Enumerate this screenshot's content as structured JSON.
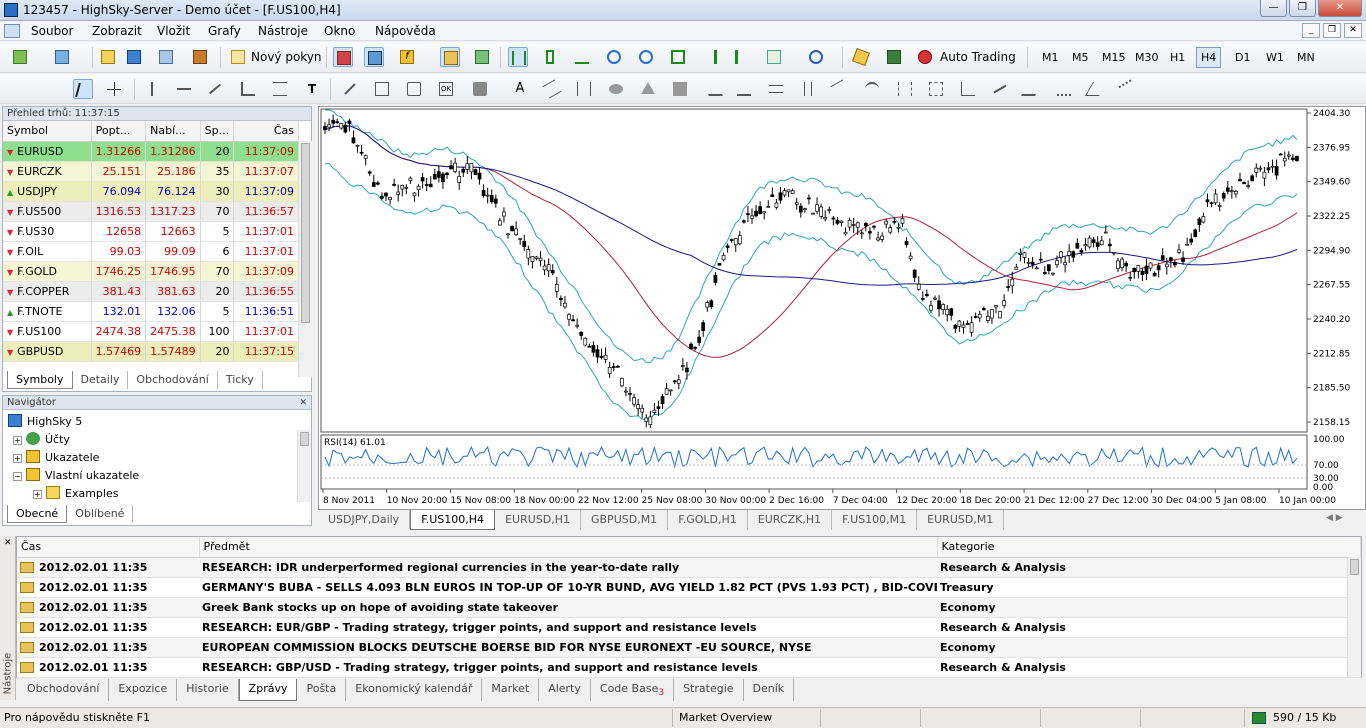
{
  "window": {
    "title": "123457 - HighSky-Server - Demo účet - [F.US100,H4]"
  },
  "menu": [
    "Soubor",
    "Zobrazit",
    "Vložit",
    "Grafy",
    "Nástroje",
    "Okno",
    "Nápověda"
  ],
  "toolbar": {
    "new_order_label": "Nový pokyn",
    "auto_trading_label": "Auto Trading"
  },
  "timeframes": [
    "M1",
    "M5",
    "M15",
    "M30",
    "H1",
    "H4",
    "D1",
    "W1",
    "MN"
  ],
  "timeframe_active": "H4",
  "market_watch": {
    "header": "Přehled trhů: 11:37:15",
    "columns": [
      "Symbol",
      "Popt...",
      "Nabí...",
      "Sp...",
      "Čas"
    ],
    "rows": [
      {
        "symbol": "EURUSD",
        "bid": "1.31266",
        "ask": "1.31286",
        "spread": "20",
        "time": "11:37:09",
        "dir": "dn",
        "bg": "#8ee08e"
      },
      {
        "symbol": "EURCZK",
        "bid": "25.151",
        "ask": "25.186",
        "spread": "35",
        "time": "11:37:07",
        "dir": "dn",
        "bg": "#f6f6d4"
      },
      {
        "symbol": "USDJPY",
        "bid": "76.094",
        "ask": "76.124",
        "spread": "30",
        "time": "11:37:09",
        "dir": "up",
        "bg": "#eeeebb"
      },
      {
        "symbol": "F.US500",
        "bid": "1316.53",
        "ask": "1317.23",
        "spread": "70",
        "time": "11:36:57",
        "dir": "dn",
        "bg": "#ececec"
      },
      {
        "symbol": "F.US30",
        "bid": "12658",
        "ask": "12663",
        "spread": "5",
        "time": "11:37:01",
        "dir": "dn",
        "bg": "#ffffff"
      },
      {
        "symbol": "F.OIL",
        "bid": "99.03",
        "ask": "99.09",
        "spread": "6",
        "time": "11:37:01",
        "dir": "dn",
        "bg": "#ffffff"
      },
      {
        "symbol": "F.GOLD",
        "bid": "1746.25",
        "ask": "1746.95",
        "spread": "70",
        "time": "11:37:09",
        "dir": "dn",
        "bg": "#f6f6d4"
      },
      {
        "symbol": "F.COPPER",
        "bid": "381.43",
        "ask": "381.63",
        "spread": "20",
        "time": "11:36:55",
        "dir": "dn",
        "bg": "#ececec"
      },
      {
        "symbol": "F.TNOTE",
        "bid": "132.01",
        "ask": "132.06",
        "spread": "5",
        "time": "11:36:51",
        "dir": "up",
        "bg": "#ffffff"
      },
      {
        "symbol": "F.US100",
        "bid": "2474.38",
        "ask": "2475.38",
        "spread": "100",
        "time": "11:37:01",
        "dir": "dn",
        "bg": "#ffffff"
      },
      {
        "symbol": "GBPUSD",
        "bid": "1.57469",
        "ask": "1.57489",
        "spread": "20",
        "time": "11:37:15",
        "dir": "dn",
        "bg": "#eeeebb"
      }
    ],
    "tabs": [
      "Symboly",
      "Detaily",
      "Obchodování",
      "Ticky"
    ]
  },
  "navigator": {
    "header": "Navigátor",
    "items": [
      "HighSky 5",
      "Účty",
      "Ukazatele",
      "Vlastní ukazatele",
      "Examples"
    ],
    "tabs": [
      "Obecné",
      "Oblíbené"
    ]
  },
  "chart": {
    "price_labels": [
      "2404.30",
      "2376.95",
      "2349.60",
      "2322.25",
      "2294.90",
      "2267.55",
      "2240.20",
      "2212.85",
      "2185.50",
      "2158.15"
    ],
    "rsi_label": "RSI(14) 61.01",
    "rsi_labels": [
      "100.00",
      "70.00",
      "30.00",
      "0.00"
    ],
    "date_labels": [
      "8 Nov 2011",
      "10 Nov 20:00",
      "15 Nov 08:00",
      "18 Nov 00:00",
      "22 Nov 12:00",
      "25 Nov 08:00",
      "30 Nov 00:00",
      "2 Dec 16:00",
      "7 Dec 04:00",
      "12 Dec 20:00",
      "18 Dec 20:00",
      "21 Dec 12:00",
      "27 Dec 12:00",
      "30 Dec 04:00",
      "5 Jan 08:00",
      "10 Jan 00:00"
    ],
    "colors": {
      "bollinger": "#2aa7b8",
      "ma_slow": "#1a1a80",
      "ma_fast": "#b0203a",
      "rsi": "#1e6fcf",
      "candles": "#000000"
    }
  },
  "chart_tabs": [
    "USDJPY,Daily",
    "F.US100,H4",
    "EURUSD,H1",
    "GBPUSD,M1",
    "F.GOLD,H1",
    "EURCZK,H1",
    "F.US100,M1",
    "EURUSD,M1"
  ],
  "news": {
    "columns": [
      "Čas",
      "Předmět",
      "Kategorie"
    ],
    "rows": [
      {
        "time": "2012.02.01 11:35",
        "subject": "RESEARCH: IDR underperformed regional currencies in the year-to-date rally",
        "category": "Research & Analysis"
      },
      {
        "time": "2012.02.01 11:35",
        "subject": "GERMANY'S BUBA - SELLS 4.093 BLN EUROS IN TOP-UP OF 10-YR BUND, AVG YIELD 1.82 PCT (PVS 1.93 PCT) , BID-COVER 1.4 (PV...",
        "category": "Treasury"
      },
      {
        "time": "2012.02.01 11:35",
        "subject": "Greek Bank stocks up on hope of avoiding state takeover",
        "category": "Economy"
      },
      {
        "time": "2012.02.01 11:35",
        "subject": "RESEARCH: EUR/GBP - Trading strategy, trigger points, and support and resistance levels",
        "category": "Research & Analysis"
      },
      {
        "time": "2012.02.01 11:35",
        "subject": "EUROPEAN COMMISSION BLOCKS DEUTSCHE BOERSE BID FOR NYSE EURONEXT -EU SOURCE, NYSE",
        "category": "Economy"
      },
      {
        "time": "2012.02.01 11:35",
        "subject": "RESEARCH: GBP/USD - Trading strategy, trigger points, and support and resistance levels",
        "category": "Research & Analysis"
      }
    ]
  },
  "terminal_label": "Nástroje",
  "terminal_tabs": [
    "Obchodování",
    "Expozice",
    "Historie",
    "Zprávy",
    "Pošta",
    "Ekonomický kalendář",
    "Market",
    "Alerty",
    "Code Base",
    "Strategie",
    "Deník"
  ],
  "terminal_active": "Zprávy",
  "code_base_badge": "3",
  "status": {
    "help": "Pro nápovědu stiskněte F1",
    "profile": "Market Overview",
    "traffic": "590 / 15 Kb"
  }
}
